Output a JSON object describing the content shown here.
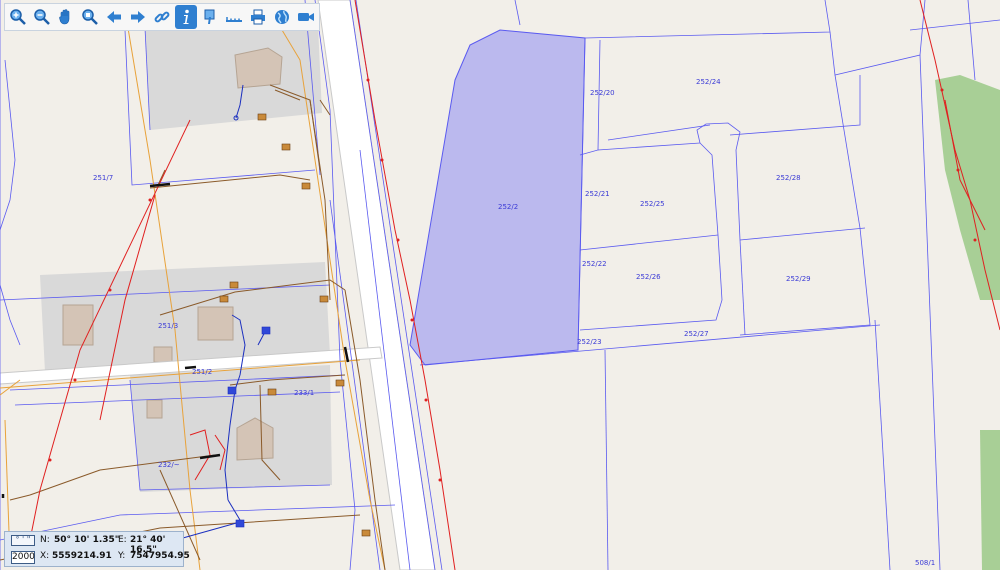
{
  "toolbar": {
    "tools": [
      {
        "icon": "zoom-in-icon"
      },
      {
        "icon": "zoom-out-icon"
      },
      {
        "icon": "pan-hand-icon"
      },
      {
        "icon": "zoom-extent-icon"
      },
      {
        "icon": "back-arrow-icon"
      },
      {
        "icon": "forward-arrow-icon"
      },
      {
        "icon": "link-icon"
      },
      {
        "icon": "info-icon",
        "active": true
      },
      {
        "icon": "info-pointer-icon"
      },
      {
        "icon": "measure-ruler-icon"
      },
      {
        "icon": "print-icon"
      },
      {
        "icon": "globe-icon"
      },
      {
        "icon": "video-camera-icon"
      }
    ]
  },
  "coords": {
    "format_button": "° ' \"",
    "scale": "2000",
    "n_label": "N:",
    "n_value": "50° 10' 1.35\"",
    "e_label": "E:",
    "e_value": "21° 40' 16.5\"",
    "x_label": "X:",
    "x_value": "5559214.91",
    "y_label": "Y:",
    "y_value": "7547954.95"
  },
  "parcels": {
    "p251_7": "251/7",
    "p251_3": "251/3",
    "p251_2": "251/2",
    "p233_1": "233/1",
    "p232": "232/~",
    "p252_2": "252/2",
    "p252_20": "252/20",
    "p252_21": "252/21",
    "p252_22": "252/22",
    "p252_23": "252/23",
    "p252_24": "252/24",
    "p252_25": "252/25",
    "p252_26": "252/26",
    "p252_27": "252/27",
    "p252_28": "252/28",
    "p252_29": "252/29",
    "p508_1": "508/1"
  },
  "colors": {
    "background": "#f2efe9",
    "parcel_border": "#5a5af0",
    "selected_parcel": "#bbb9ee",
    "building_area": "#d9d9d9",
    "building": "#d4c4b6",
    "power_line": "#e02020",
    "gas_line": "#8a5a2a",
    "water_line": "#1b2fbf",
    "road": "#ffffff",
    "forest": "#a8cf96"
  }
}
